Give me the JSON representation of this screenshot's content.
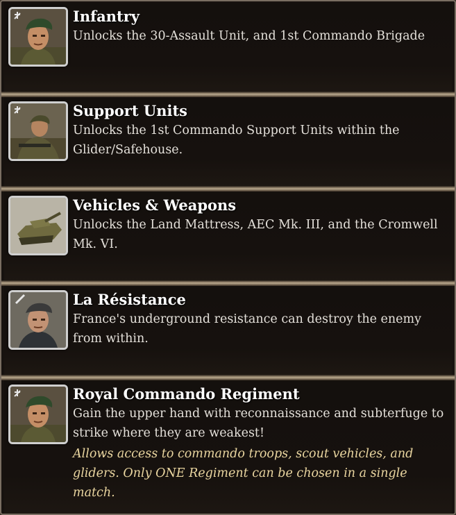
{
  "entries": [
    {
      "icon": "commando-soldier-portrait-icon",
      "title": "Infantry",
      "description": "Unlocks the 30-Assault Unit, and 1st Commando Brigade"
    },
    {
      "icon": "support-soldier-portrait-icon",
      "title": "Support Units",
      "description": "Unlocks the 1st Commando Support Units within the Glider/Safehouse."
    },
    {
      "icon": "tank-portrait-icon",
      "title": "Vehicles & Weapons",
      "description": "Unlocks the Land Mattress, AEC Mk. III, and the Cromwell Mk. VI."
    },
    {
      "icon": "resistance-fighter-portrait-icon",
      "title": "La Résistance",
      "description": "France's underground resistance can destroy the enemy from within."
    },
    {
      "icon": "commando-soldier-portrait-icon",
      "title": "Royal Commando Regiment",
      "description": "Gain the upper hand with reconnaissance and subterfuge to strike where they are weakest!",
      "note": "Allows access to commando troops, scout vehicles, and gliders. Only ONE Regiment can be chosen in a single match."
    }
  ]
}
